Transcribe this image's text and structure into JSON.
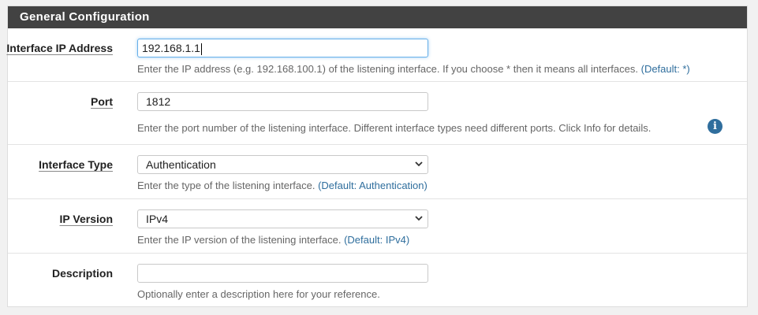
{
  "panel": {
    "title": "General Configuration"
  },
  "fields": {
    "ip_address": {
      "label": "Interface IP Address",
      "value": "192.168.1.1",
      "help": "Enter the IP address (e.g. 192.168.100.1) of the listening interface. If you choose * then it means all interfaces.",
      "default": "(Default: *)"
    },
    "port": {
      "label": "Port",
      "value": "1812",
      "help": "Enter the port number of the listening interface. Different interface types need different ports. Click Info for details.",
      "info_icon": "info-icon"
    },
    "interface_type": {
      "label": "Interface Type",
      "selected": "Authentication",
      "help": "Enter the type of the listening interface.",
      "default": "(Default: Authentication)"
    },
    "ip_version": {
      "label": "IP Version",
      "selected": "IPv4",
      "help": "Enter the IP version of the listening interface.",
      "default": "(Default: IPv4)"
    },
    "description": {
      "label": "Description",
      "value": "",
      "help": "Optionally enter a description here for your reference."
    }
  },
  "colors": {
    "header_bg": "#424242",
    "link": "#2f6e9d",
    "help_text": "#666666",
    "focus_border": "#66afe9"
  }
}
